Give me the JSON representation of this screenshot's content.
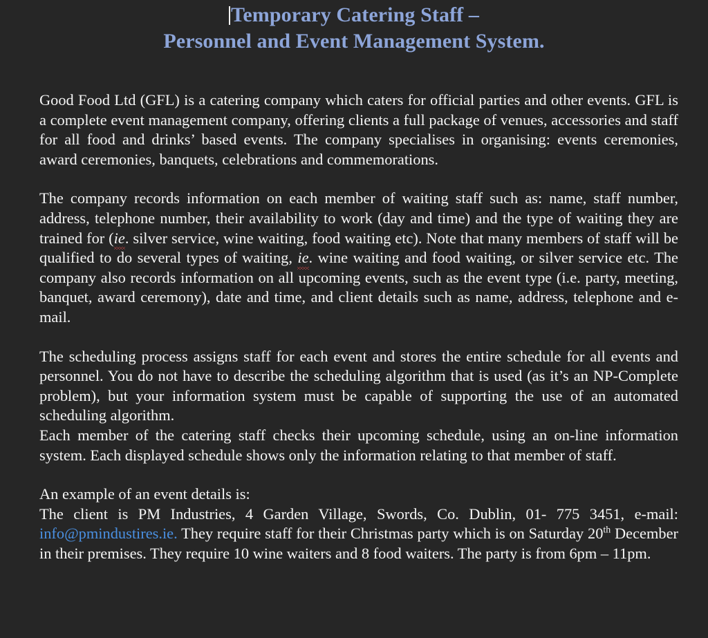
{
  "document": {
    "background_color": "#262626",
    "body_text_color": "#f5f5f5",
    "title_color": "#8da5d9",
    "link_color": "#4a90e2",
    "spellcheck_underline_color": "#e04a4a",
    "title": {
      "line1": "Temporary Catering Staff –",
      "line2": "Personnel and Event Management System."
    },
    "paragraphs": {
      "p1": "Good Food Ltd (GFL) is a catering company which caters for official parties and other events. GFL is a complete event management company, offering clients a full package of venues, accessories and staff for all food and drinks’ based events. The company specialises in organising: events ceremonies, award ceremonies, banquets, celebrations and commemorations.",
      "p2_a": "The company records information on each member of waiting staff such as: name, staff number, address, telephone number, their availability to work (day and time) and the type of waiting they are trained for (",
      "p2_ie1": "ie",
      "p2_b": ". silver service, wine waiting, food waiting etc). Note that many members of staff will be qualified to do several types of waiting, ",
      "p2_ie2": "ie",
      "p2_c": ". wine waiting and food waiting, or silver service etc. The company also records information on all upcoming events, such as the event type (i.e. party, meeting, banquet, award ceremony), date and time, and client details such as name, address, telephone and e-mail.",
      "p3": "The scheduling process assigns staff for each event and stores the entire schedule for all events and personnel. You do not have to describe the scheduling algorithm that is used (as it’s an NP-Complete problem), but your information system must be capable of supporting the use of an automated scheduling algorithm.",
      "p4": "Each member of the catering staff checks their upcoming schedule, using an on-line information system. Each displayed schedule shows only the information relating to that member of staff.",
      "p5_line1": "An example of an event details is:",
      "p5_a": "The client is PM Industries, 4 Garden Village, Swords, Co. Dublin, 01- 775 3451, e-mail:",
      "p5_email": "info@pmindustires.ie.",
      "p5_b": " They require staff for their Christmas party which is on Saturday 20",
      "p5_sup": "th",
      "p5_c": " December in their premises. They require 10 wine waiters and 8 food waiters. The party is from 6pm – 11pm."
    }
  }
}
